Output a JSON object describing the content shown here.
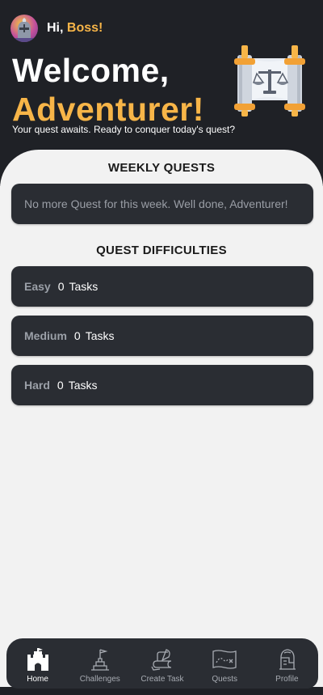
{
  "header": {
    "greeting_prefix": "Hi, ",
    "user_name": "Boss!",
    "title_line1": "Welcome,",
    "title_line2": "Adventurer!",
    "tagline": "Your quest awaits. Ready to conquer today's quest?"
  },
  "weekly": {
    "title": "WEEKLY QUESTS",
    "empty_message": "No more Quest for this week. Well done, Adventurer!"
  },
  "difficulties": {
    "title": "QUEST DIFFICULTIES",
    "items": [
      {
        "label": "Easy",
        "count": "0",
        "unit": "Tasks"
      },
      {
        "label": "Medium",
        "count": "0",
        "unit": "Tasks"
      },
      {
        "label": "Hard",
        "count": "0",
        "unit": "Tasks"
      }
    ]
  },
  "nav": {
    "items": [
      {
        "label": "Home",
        "icon": "castle-icon",
        "active": true
      },
      {
        "label": "Challenges",
        "icon": "summit-flag-icon",
        "active": false
      },
      {
        "label": "Create Task",
        "icon": "quill-scroll-icon",
        "active": false
      },
      {
        "label": "Quests",
        "icon": "treasure-map-icon",
        "active": false
      },
      {
        "label": "Profile",
        "icon": "helmet-icon",
        "active": false
      }
    ]
  },
  "colors": {
    "header_bg": "#1f2126",
    "accent_gold": "#f7b548",
    "card_bg": "#2a2d33",
    "page_bg": "#f2f2f2"
  }
}
